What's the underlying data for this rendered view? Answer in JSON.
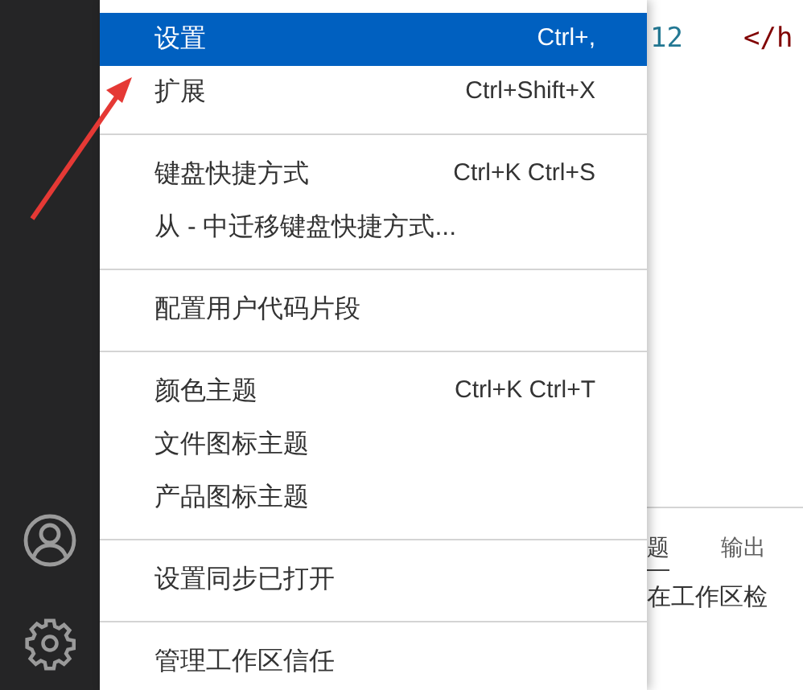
{
  "menu": {
    "groups": [
      {
        "items": [
          {
            "label": "设置",
            "shortcut": "Ctrl+,",
            "selected": true
          },
          {
            "label": "扩展",
            "shortcut": "Ctrl+Shift+X",
            "selected": false
          }
        ]
      },
      {
        "items": [
          {
            "label": "键盘快捷方式",
            "shortcut": "Ctrl+K Ctrl+S",
            "selected": false
          },
          {
            "label": "从 - 中迁移键盘快捷方式...",
            "selected": false
          }
        ]
      },
      {
        "items": [
          {
            "label": "配置用户代码片段",
            "selected": false
          }
        ]
      },
      {
        "items": [
          {
            "label": "颜色主题",
            "shortcut": "Ctrl+K Ctrl+T",
            "selected": false
          },
          {
            "label": "文件图标主题",
            "selected": false
          },
          {
            "label": "产品图标主题",
            "selected": false
          }
        ]
      },
      {
        "items": [
          {
            "label": "设置同步已打开",
            "selected": false
          }
        ]
      },
      {
        "items": [
          {
            "label": "管理工作区信任",
            "selected": false
          }
        ]
      }
    ]
  },
  "editor": {
    "lines": [
      {
        "number": "12",
        "code": "</h"
      }
    ]
  },
  "panel": {
    "tabs": [
      {
        "label": "题",
        "selected": true
      },
      {
        "label": "输出",
        "selected": false
      }
    ],
    "message": "在工作区检"
  }
}
